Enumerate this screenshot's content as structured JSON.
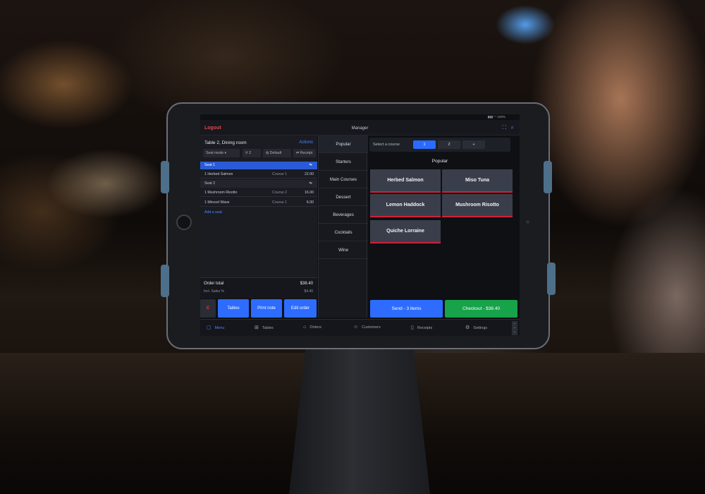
{
  "topbar": {
    "logout": "Logout",
    "role": "Manager",
    "status": "▮▮▮ ◠ 100%"
  },
  "order": {
    "title": "Table 2, Dining room",
    "actions": "Actions",
    "tools": {
      "seat_mode": "Seat mode",
      "guests": "2",
      "default": "Default",
      "receipt": "Receipt"
    },
    "seats": [
      {
        "label": "Seat 1"
      },
      {
        "label": "Seat 2"
      }
    ],
    "lines": [
      {
        "name": "1 Herbed Salmon",
        "course": "Course 1",
        "price": "22.00"
      },
      {
        "name": "1 Mushroom Risotto",
        "course": "Course 2",
        "price": "16.00"
      },
      {
        "name": "1 Minced Wave",
        "course": "Course 1",
        "price": "6.00"
      }
    ],
    "add_seat": "Add a seat",
    "total_label": "Order total",
    "total_value": "$38.40",
    "tax_label": "Incl. Sales %",
    "tax_value": "$4.40",
    "buttons": {
      "clear": "C",
      "tables": "Tables",
      "print": "Print note",
      "edit": "Edit order"
    }
  },
  "categories": [
    "Popular",
    "Starters",
    "Main Courses",
    "Dessert",
    "Beverages",
    "Cocktails",
    "Wine"
  ],
  "course": {
    "label": "Select a course",
    "options": [
      "1",
      "2",
      "+"
    ]
  },
  "menu": {
    "title": "Popular",
    "items": [
      "Herbed Salmon",
      "Miso Tuna",
      "Lemon Haddock",
      "Mushroom Risotto",
      "Quiche Lorraine"
    ]
  },
  "send_label": "Send - 3 items",
  "checkout_label": "Checkout - $38.40",
  "nav": [
    "Menu",
    "Tables",
    "Orders",
    "Customers",
    "Receipts",
    "Settings"
  ],
  "colors": {
    "accent": "#2d6cff",
    "checkout": "#17a34a",
    "danger": "#e0464b",
    "item_underline": "#d0213a"
  }
}
